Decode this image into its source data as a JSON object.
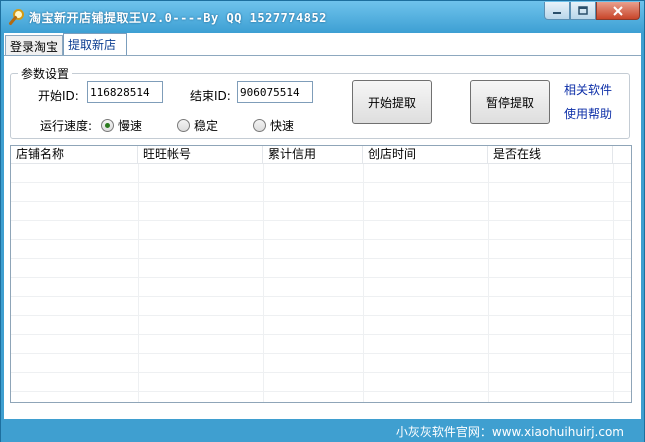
{
  "window": {
    "title": "淘宝新开店铺提取王V2.0----By QQ 1527774852"
  },
  "tabs": [
    {
      "label": "登录淘宝",
      "active": false
    },
    {
      "label": "提取新店",
      "active": true
    }
  ],
  "params": {
    "group_title": "参数设置",
    "start_id_label": "开始ID:",
    "start_id_value": "116828514",
    "end_id_label": "结束ID:",
    "end_id_value": "906075514",
    "speed_label": "运行速度:",
    "speed_options": [
      {
        "label": "慢速",
        "selected": true
      },
      {
        "label": "稳定",
        "selected": false
      },
      {
        "label": "快速",
        "selected": false
      }
    ],
    "start_button": "开始提取",
    "pause_button": "暂停提取",
    "link_related": "相关软件",
    "link_help": "使用帮助"
  },
  "table": {
    "columns": [
      "店铺名称",
      "旺旺帐号",
      "累计信用",
      "创店时间",
      "是否在线"
    ],
    "rows": []
  },
  "status": {
    "text": "小灰灰软件官网：www.xiaohuihuirj.com"
  },
  "colors": {
    "frame": "#3f9fd0",
    "link": "#0d2fa8",
    "radio_selected": "#2b7a1e"
  },
  "icons": {
    "app": "search-magnifier-icon",
    "minimize": "minimize-icon",
    "maximize": "maximize-icon",
    "close": "close-icon"
  }
}
